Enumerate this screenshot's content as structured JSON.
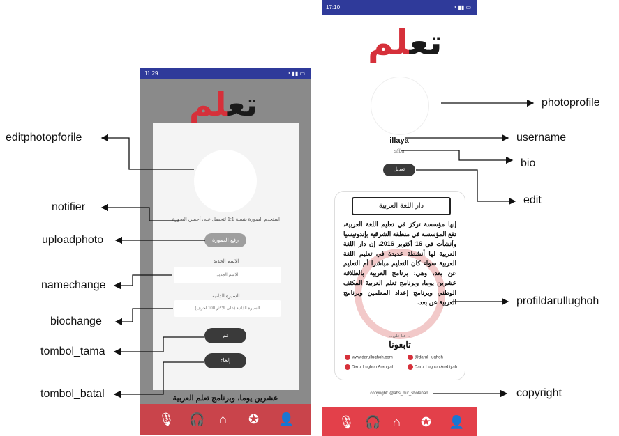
{
  "phone1": {
    "status_left": "11:29",
    "logo_red": "لم",
    "logo_black": "تع",
    "notifier": "استخدم الصورة بنسبة 1:1 لتحصل على أحسن الصورة",
    "upload_button": "رفع الصورة",
    "name_label": "الاسم الجديد",
    "name_placeholder": "الاسم الجديد",
    "bio_label": "السيرة الذاتية",
    "bio_placeholder": "(على الأكثر 100 أحرف) السيرة الذاتية",
    "ok_button": "تم",
    "cancel_button": "إلغاء",
    "footer_text": "عشرين يوما، وبرنامج تعلم العربية",
    "nav_icons": [
      "mic-icon",
      "headphones-icon",
      "home-icon",
      "award-icon",
      "user-icon"
    ]
  },
  "phone2": {
    "status_left": "17:10",
    "logo_red": "لم",
    "logo_black": "تع",
    "username": "illaya",
    "bio": "stiba",
    "edit_button": "تعديل",
    "banner": "دار اللغة العربية",
    "paragraph": "إنها مؤسسة تركز في تعليم اللغة العربية، تقع المؤسسة في منطقة الشرقية بإندونيسيا وأنشأت في 16 أكتوبر 2016. إن دار اللغة العربية لها أنشطة عديدة في تعليم اللغة العربية سواء كان التعليم مباشرا أم التعليم عن بعد، وهي: برنامج العربية بالطلاقة عشرين يوما، وبرنامج تعلم العربية المكثف الوطني وبرنامج إعداد المعلمين وبرنامج العربية عن بعد.",
    "follow_small": "...عنا على ...",
    "follow_title": "تابعونا",
    "social": [
      "www.darullughoh.com",
      "@darul_lughoh",
      "Darul Lughoh Arabiyah",
      "Darul Lughoh Arabiyah"
    ],
    "copyright": "copyright: @ahs_nur_sholehan",
    "nav_icons": [
      "mic-icon",
      "headphones-icon",
      "home-icon",
      "award-icon",
      "user-icon"
    ]
  },
  "labels": {
    "editphotoprofile": "editphotopforile",
    "notifier": "notifier",
    "uploadphoto": "uploadphoto",
    "namechange": "namechange",
    "biochange": "biochange",
    "tombol_tama": "tombol_tama",
    "tombol_batal": "tombol_batal",
    "photoprofile": "photoprofile",
    "username": "username",
    "bio": "bio",
    "edit": "edit",
    "profildarullughoh": "profildarullughoh",
    "copyright": "copyright"
  },
  "colors": {
    "accent_red": "#d6303a",
    "statusbar_blue": "#2f3a9a",
    "dark_button": "#3a3a3a"
  }
}
